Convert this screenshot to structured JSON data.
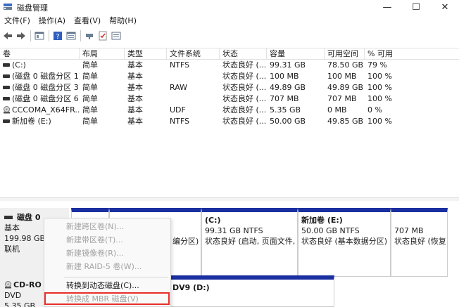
{
  "window": {
    "title": "磁盘管理",
    "min": "—",
    "max": "☐",
    "close": "✕"
  },
  "menu": [
    "文件(F)",
    "操作(A)",
    "查看(V)",
    "帮助(H)"
  ],
  "table": {
    "headers": [
      "卷",
      "布局",
      "类型",
      "文件系统",
      "状态",
      "容量",
      "可用空间",
      "% 可用"
    ],
    "rows": [
      {
        "vol": "(C:)",
        "layout": "简单",
        "type": "基本",
        "fs": "NTFS",
        "status": "状态良好 (...",
        "cap": "99.31 GB",
        "free": "78.50 GB",
        "pct": "79 %",
        "icon": "disk-volume-icon"
      },
      {
        "vol": "(磁盘 0 磁盘分区 1)",
        "layout": "简单",
        "type": "基本",
        "fs": "",
        "status": "状态良好 (...",
        "cap": "100 MB",
        "free": "100 MB",
        "pct": "100 %",
        "icon": "disk-volume-icon"
      },
      {
        "vol": "(磁盘 0 磁盘分区 3)",
        "layout": "简单",
        "type": "基本",
        "fs": "RAW",
        "status": "状态良好 (...",
        "cap": "49.89 GB",
        "free": "49.89 GB",
        "pct": "100 %",
        "icon": "disk-volume-icon"
      },
      {
        "vol": "(磁盘 0 磁盘分区 6)",
        "layout": "简单",
        "type": "基本",
        "fs": "",
        "status": "状态良好 (...",
        "cap": "707 MB",
        "free": "707 MB",
        "pct": "100 %",
        "icon": "disk-volume-icon"
      },
      {
        "vol": "CCCOMA_X64FR...",
        "layout": "简单",
        "type": "基本",
        "fs": "UDF",
        "status": "状态良好 (...",
        "cap": "5.35 GB",
        "free": "0 MB",
        "pct": "0 %",
        "icon": "cd-drive-icon"
      },
      {
        "vol": "新加卷 (E:)",
        "layout": "简单",
        "type": "基本",
        "fs": "NTFS",
        "status": "状态良好 (...",
        "cap": "50.00 GB",
        "free": "49.85 GB",
        "pct": "100 %",
        "icon": "disk-volume-icon"
      }
    ]
  },
  "disks": {
    "disk0": {
      "name": "磁盘 0",
      "type": "基本",
      "size": "199.98 GB",
      "state": "联机"
    },
    "cdrom": {
      "name": "CD-RO",
      "type": "DVD",
      "size": "5.35 GB"
    }
  },
  "partitions": {
    "p_partial": {
      "line3": "编分区)"
    },
    "c": {
      "title": "(C:)",
      "size": "99.31 GB NTFS",
      "status": "状态良好 (启动, 页面文件,"
    },
    "e": {
      "title": "新加卷  (E:)",
      "size": "50.00 GB NTFS",
      "status": "状态良好 (基本数据分区)"
    },
    "p6": {
      "size": "707 MB",
      "status": "状态良好 (恢复"
    },
    "dvd": {
      "title": "DV9  (D:)"
    }
  },
  "context_menu": {
    "items": [
      {
        "label": "新建跨区卷(N)...",
        "enabled": false
      },
      {
        "label": "新建带区卷(T)...",
        "enabled": false
      },
      {
        "label": "新建镜像卷(R)...",
        "enabled": false
      },
      {
        "label": "新建 RAID-5 卷(W)...",
        "enabled": false
      },
      {
        "label": "转换到动态磁盘(C)...",
        "enabled": true
      },
      {
        "label": "转换成 MBR 磁盘(V)",
        "enabled": false
      }
    ]
  },
  "colors": {
    "partition_header": "#1a2fa0",
    "highlight": "#e8302b",
    "disabled_text": "#a3a3a3"
  }
}
